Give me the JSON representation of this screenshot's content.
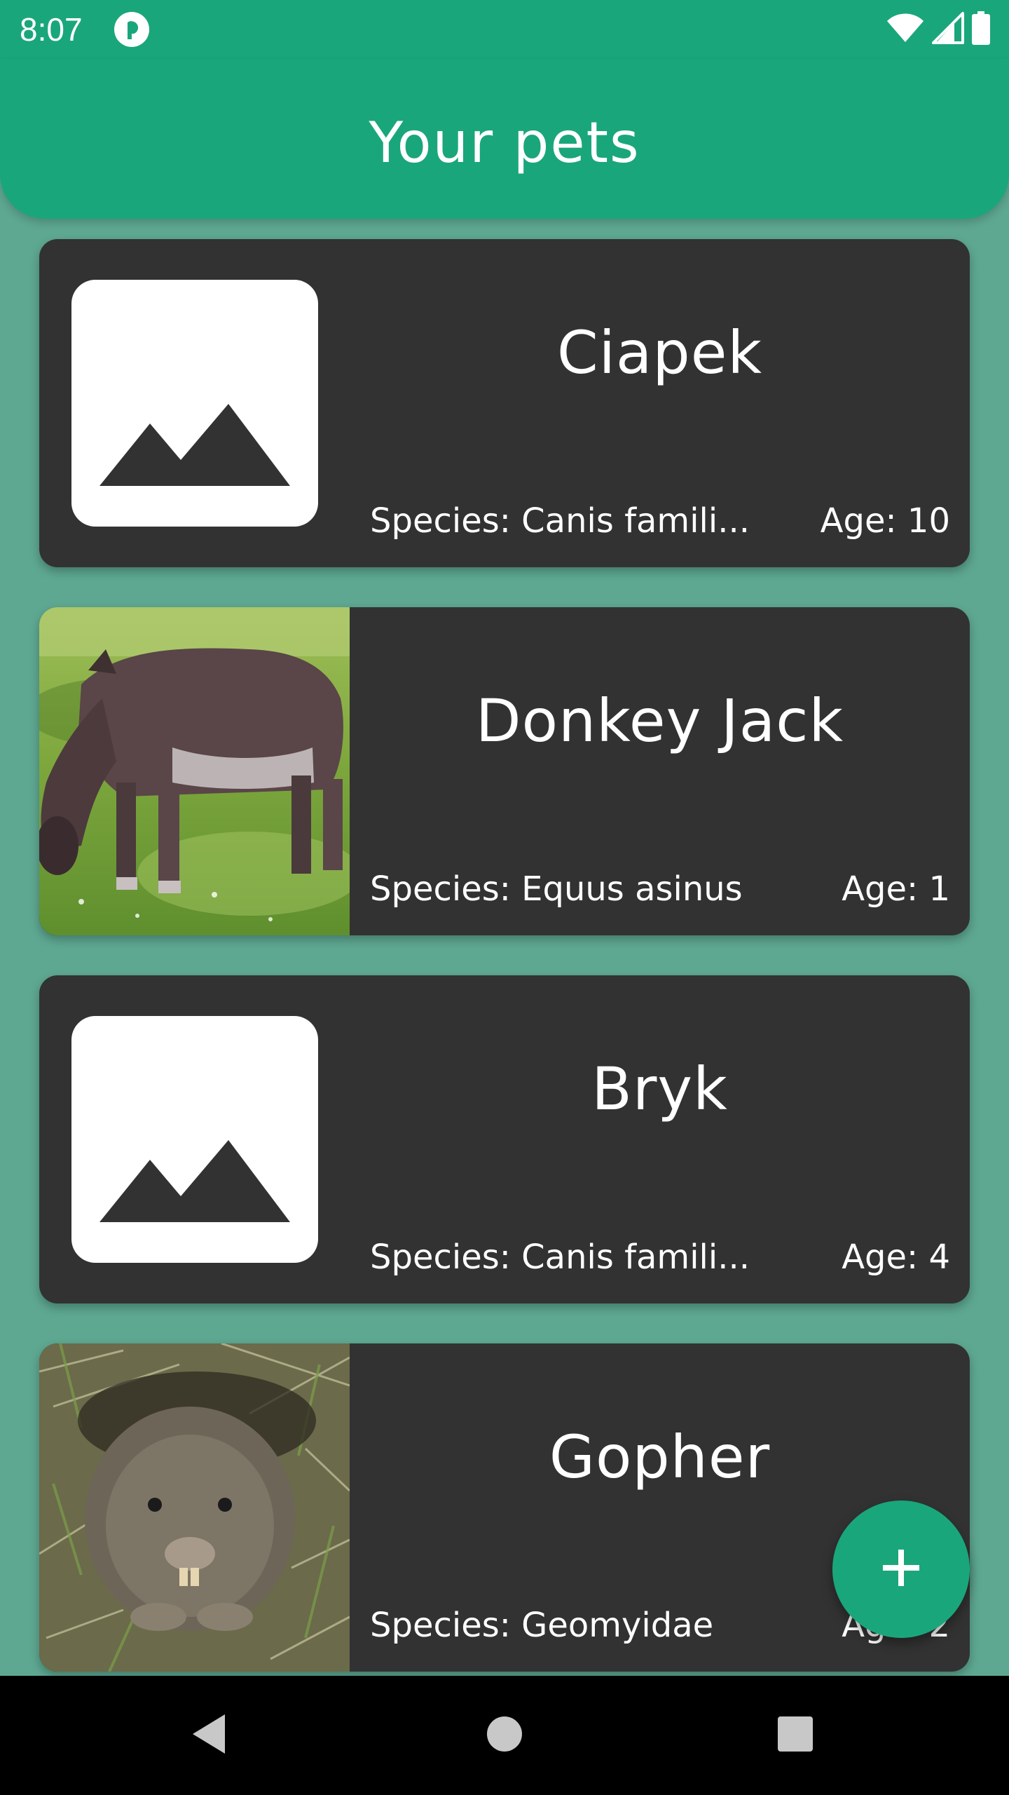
{
  "status_bar": {
    "time": "8:07",
    "icons": [
      "app-notification-icon",
      "wifi-icon",
      "signal-icon",
      "battery-icon"
    ]
  },
  "app_bar": {
    "title": "Your pets"
  },
  "pets": [
    {
      "name": "Ciapek",
      "species": "Species: Canis famili...",
      "age": "Age: 10",
      "image": "placeholder-image-icon"
    },
    {
      "name": "Donkey Jack",
      "species": "Species: Equus asinus",
      "age": "Age: 1",
      "image": "donkey-photo"
    },
    {
      "name": "Bryk",
      "species": "Species: Canis famili...",
      "age": "Age: 4",
      "image": "placeholder-image-icon"
    },
    {
      "name": "Gopher",
      "species": "Species: Geomyidae",
      "age": "Age: 2",
      "image": "gopher-photo"
    }
  ],
  "fab": {
    "icon": "plus-icon"
  },
  "nav_bar": {
    "icons": [
      "back-triangle-icon",
      "home-circle-icon",
      "recents-square-icon"
    ]
  },
  "colors": {
    "primary": "#1aa67b",
    "background": "#5ea892",
    "card": "#323232",
    "nav": "#000000"
  }
}
